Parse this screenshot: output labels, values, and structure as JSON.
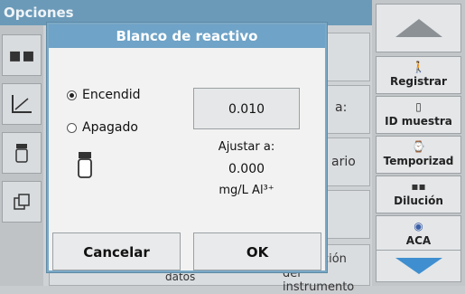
{
  "app": {
    "title": "Opciones"
  },
  "background": {
    "cell_texts": [
      "a:",
      "ario",
      "ación",
      "del instrumento",
      "datos"
    ]
  },
  "sidebar": {
    "items": [
      {
        "label": "Registrar",
        "icon": "person-icon"
      },
      {
        "label": "ID muestra",
        "icon": "vial-icon"
      },
      {
        "label": "Temporizad",
        "icon": "timer-icon"
      },
      {
        "label": "Dilución",
        "icon": "dilution-icon"
      },
      {
        "label": "ACA",
        "icon": "aca-icon"
      }
    ]
  },
  "dialog": {
    "title": "Blanco de reactivo",
    "options": [
      {
        "label": "Encendid",
        "selected": true
      },
      {
        "label": "Apagado",
        "selected": false
      }
    ],
    "value": "0.010",
    "adjust_label": "Ajustar a:",
    "adjust_value": "0.000",
    "unit": "mg/L Al³⁺",
    "cancel_label": "Cancelar",
    "ok_label": "OK"
  },
  "colors": {
    "title_bar": "#6fa3c7",
    "accent": "#7aa9c6"
  }
}
